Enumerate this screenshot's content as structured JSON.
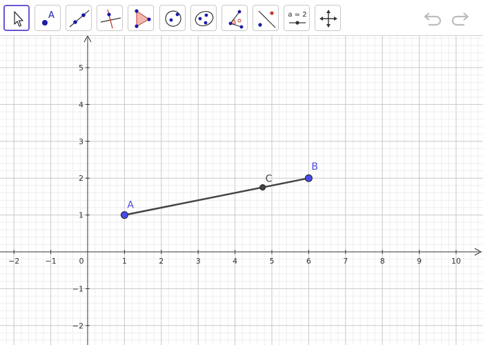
{
  "toolbar": {
    "tools": [
      {
        "id": "move",
        "icon": "cursor-arrow-icon",
        "active": true
      },
      {
        "id": "point",
        "icon": "point-icon",
        "label": "A"
      },
      {
        "id": "line",
        "icon": "line-through-points-icon"
      },
      {
        "id": "perpendicular",
        "icon": "perpendicular-line-icon"
      },
      {
        "id": "polygon",
        "icon": "polygon-icon"
      },
      {
        "id": "circle",
        "icon": "circle-center-point-icon"
      },
      {
        "id": "conic",
        "icon": "conic-ellipse-icon"
      },
      {
        "id": "angle",
        "icon": "angle-icon"
      },
      {
        "id": "reflect",
        "icon": "reflect-about-line-icon"
      },
      {
        "id": "slider",
        "icon": "slider-icon",
        "label": "a = 2"
      },
      {
        "id": "move-view",
        "icon": "move-graphics-view-icon"
      }
    ],
    "undo_icon": "undo-icon",
    "redo_icon": "redo-icon"
  },
  "graph": {
    "x_ticks": [
      "−2",
      "−1",
      "0",
      "1",
      "2",
      "3",
      "4",
      "5",
      "6",
      "7",
      "8",
      "9",
      "10"
    ],
    "y_ticks": [
      "5",
      "4",
      "3",
      "2",
      "1",
      "−1",
      "−2"
    ],
    "points": [
      {
        "name": "A",
        "x": 1,
        "y": 1,
        "color": "#4a4ae8"
      },
      {
        "name": "B",
        "x": 6,
        "y": 2,
        "color": "#4a4ae8"
      },
      {
        "name": "C",
        "x": 4.75,
        "y": 1.75,
        "color": "#444444"
      }
    ],
    "segment": {
      "from": "A",
      "to": "B",
      "color": "#444444"
    },
    "colors": {
      "grid_minor": "#eeeeee",
      "grid_major": "#c8c8c8",
      "axis": "#333333",
      "accent": "#6557d2"
    }
  }
}
